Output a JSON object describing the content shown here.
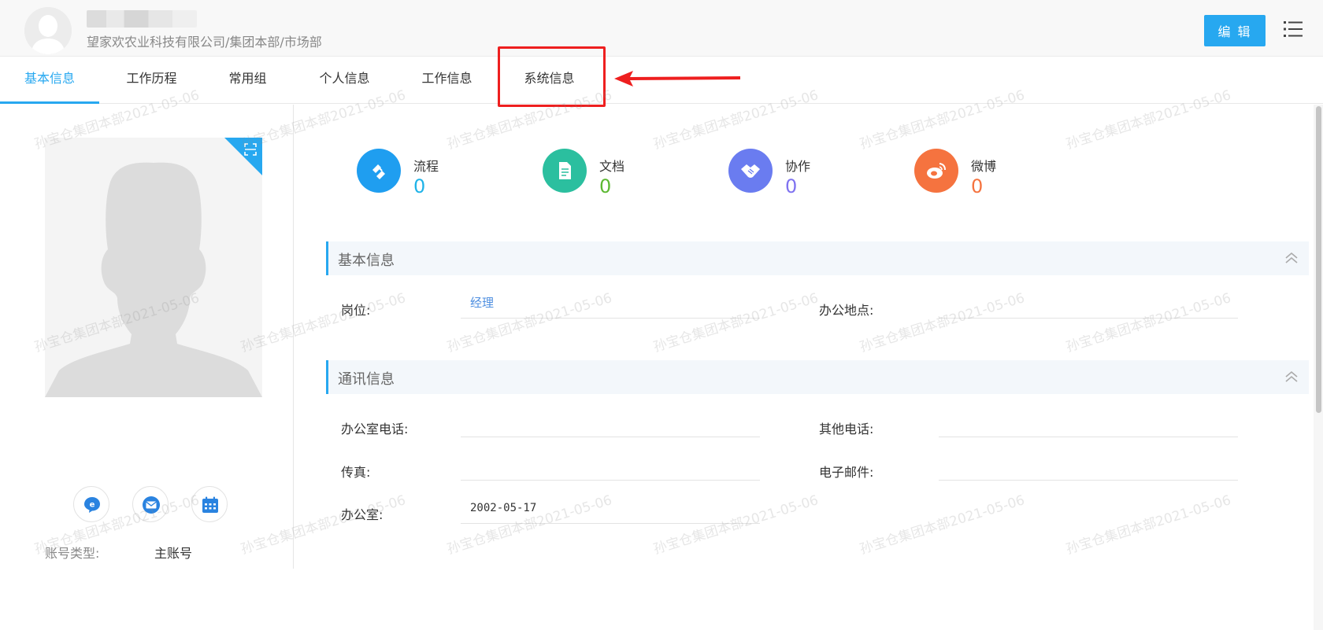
{
  "header": {
    "user_name": "██████",
    "organization": "望家欢农业科技有限公司/集团本部/市场部",
    "edit_label": "编 辑"
  },
  "tabs": [
    {
      "label": "基本信息",
      "active": true
    },
    {
      "label": "工作历程",
      "active": false
    },
    {
      "label": "常用组",
      "active": false
    },
    {
      "label": "个人信息",
      "active": false
    },
    {
      "label": "工作信息",
      "active": false
    },
    {
      "label": "系统信息",
      "active": false,
      "highlighted": true
    }
  ],
  "stats": [
    {
      "label": "流程",
      "count": "0",
      "icon": "workflow-icon",
      "color": "#1f9ef0"
    },
    {
      "label": "文档",
      "count": "0",
      "icon": "document-icon",
      "color": "#2bbf9f"
    },
    {
      "label": "协作",
      "count": "0",
      "icon": "handshake-icon",
      "color": "#6a7cf0"
    },
    {
      "label": "微博",
      "count": "0",
      "icon": "weibo-icon",
      "color": "#f5733f"
    }
  ],
  "stat_count_colors": [
    "#1fb3e8",
    "#5cb832",
    "#7f72f0",
    "#f5733f"
  ],
  "sections": {
    "basic": {
      "title": "基本信息",
      "fields": [
        {
          "label": "岗位:",
          "value": "经理"
        },
        {
          "label": "办公地点:",
          "value": ""
        }
      ]
    },
    "contact": {
      "title": "通讯信息",
      "fields": [
        {
          "label": "办公室电话:",
          "value": ""
        },
        {
          "label": "其他电话:",
          "value": ""
        },
        {
          "label": "传真:",
          "value": ""
        },
        {
          "label": "电子邮件:",
          "value": ""
        },
        {
          "label": "办公室:",
          "value": "2002-05-17"
        }
      ]
    }
  },
  "account": {
    "label": "账号类型:",
    "value": "主账号"
  },
  "watermark": "孙宝仓集团本部2021-05-06",
  "colors": {
    "accent": "#27a8f0",
    "highlight": "#ee1f1f"
  }
}
